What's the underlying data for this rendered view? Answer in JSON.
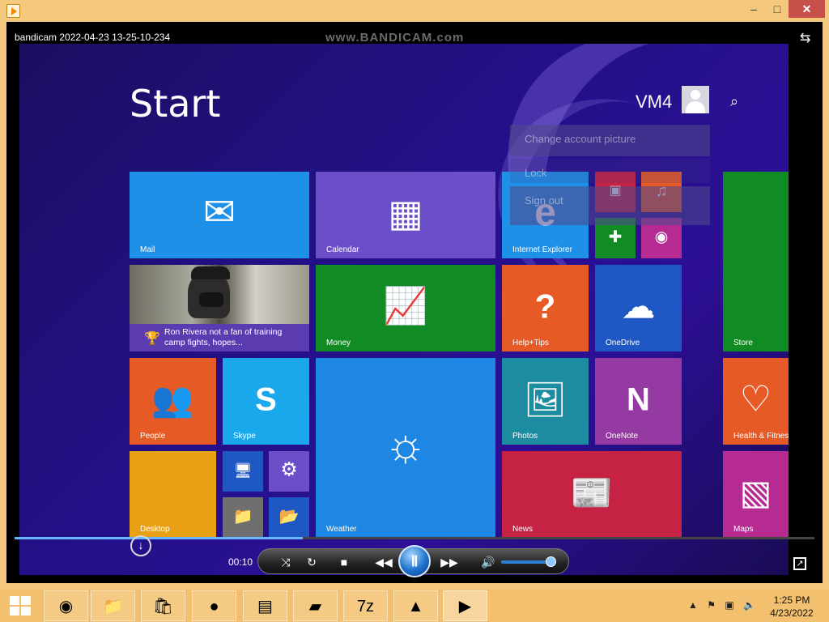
{
  "window": {
    "title": "",
    "controls": {
      "minimize": "–",
      "maximize": "□",
      "close": "✕"
    }
  },
  "player": {
    "file_title": "bandicam 2022-04-23 13-25-10-234",
    "watermark": "www.BANDICAM.com",
    "progress": 0.36,
    "time": "00:10",
    "volume": 0.95,
    "buttons": {
      "shuffle": "⤨",
      "repeat": "↻",
      "stop": "■",
      "previous": "◀◀",
      "play_pause": "Ⅱ",
      "next": "▶▶",
      "mute": "🔊"
    },
    "icons": {
      "switch_library": "switch-to-library-icon",
      "download": "download-icon",
      "fullscreen": "expand-icon"
    }
  },
  "start_screen": {
    "title": "Start",
    "user": "VM4",
    "account_menu": {
      "change_picture": "Change account picture",
      "lock": "Lock",
      "sign_out": "Sign out"
    },
    "tiles": {
      "mail": "Mail",
      "calendar": "Calendar",
      "internet_explorer": "Internet Explorer",
      "sports_text": "Ron Rivera not a fan of training camp fights, hopes...",
      "money": "Money",
      "help_tips": "Help+Tips",
      "onedrive": "OneDrive",
      "store": "Store",
      "people": "People",
      "skype": "Skype",
      "weather": "Weather",
      "photos": "Photos",
      "onenote": "OneNote",
      "health": "Health & Fitness",
      "desktop": "Desktop",
      "news": "News",
      "maps": "Maps"
    },
    "colors": {
      "blue": "#1f90e8",
      "purple": "#6b4ec8",
      "green": "#118b24",
      "orange": "#e65a25",
      "pink": "#b52b92",
      "red": "#c62244",
      "darkblue": "#1f58c5",
      "teal": "#1d8ba0"
    }
  },
  "taskbar": {
    "time": "1:25 PM",
    "date": "4/23/2022",
    "apps": [
      "chrome-icon",
      "file-explorer-icon",
      "store-icon",
      "bandicam-record-icon",
      "control-panel-icon",
      "notepad-icon",
      "7zip-icon",
      "app-icon",
      "media-player-icon"
    ],
    "zip_label": "7z"
  }
}
